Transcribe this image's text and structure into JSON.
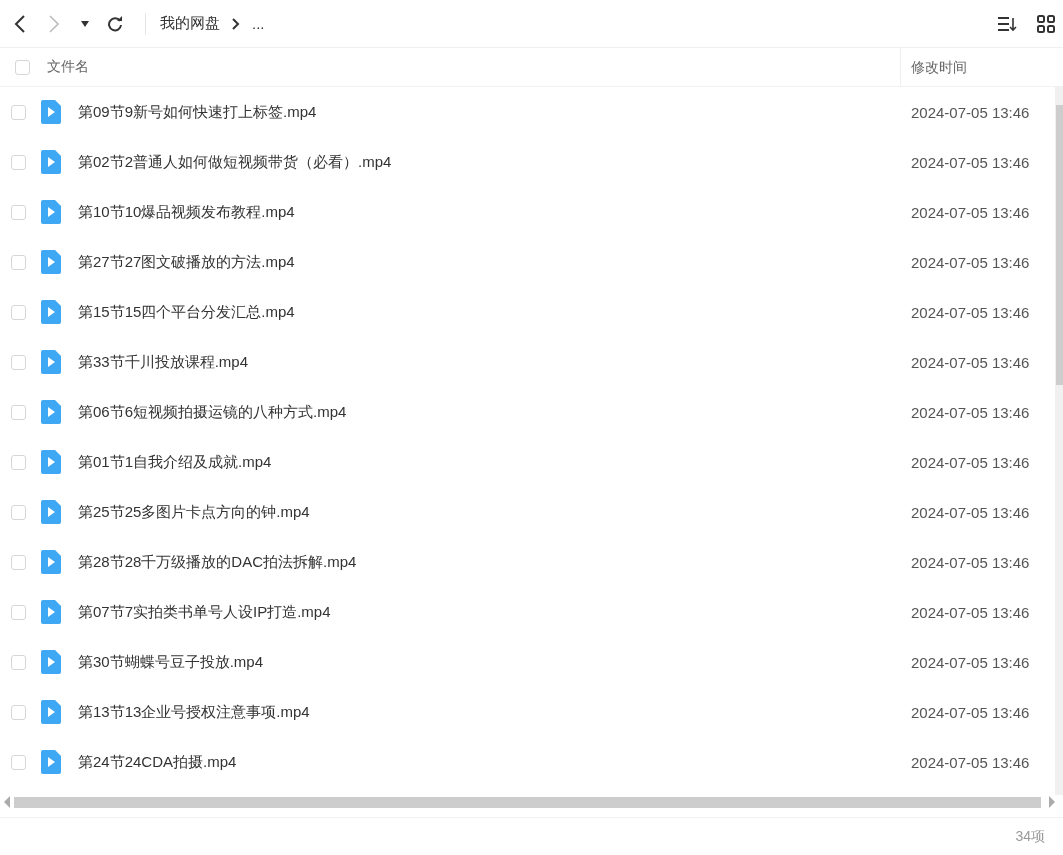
{
  "toolbar": {
    "breadcrumb": [
      "我的网盘",
      "..."
    ]
  },
  "table": {
    "columns": [
      "文件名",
      "修改时间"
    ],
    "all_checked": false,
    "rows": [
      {
        "name": "第09节9新号如何快速打上标签.mp4",
        "modified": "2024-07-05 13:46",
        "checked": false
      },
      {
        "name": "第02节2普通人如何做短视频带货（必看）.mp4",
        "modified": "2024-07-05 13:46",
        "checked": false
      },
      {
        "name": "第10节10爆品视频发布教程.mp4",
        "modified": "2024-07-05 13:46",
        "checked": false
      },
      {
        "name": "第27节27图文破播放的方法.mp4",
        "modified": "2024-07-05 13:46",
        "checked": false
      },
      {
        "name": "第15节15四个平台分发汇总.mp4",
        "modified": "2024-07-05 13:46",
        "checked": false
      },
      {
        "name": "第33节千川投放课程.mp4",
        "modified": "2024-07-05 13:46",
        "checked": false
      },
      {
        "name": "第06节6短视频拍摄运镜的八种方式.mp4",
        "modified": "2024-07-05 13:46",
        "checked": false
      },
      {
        "name": "第01节1自我介绍及成就.mp4",
        "modified": "2024-07-05 13:46",
        "checked": false
      },
      {
        "name": "第25节25多图片卡点方向的钟.mp4",
        "modified": "2024-07-05 13:46",
        "checked": false
      },
      {
        "name": "第28节28千万级播放的DAC拍法拆解.mp4",
        "modified": "2024-07-05 13:46",
        "checked": false
      },
      {
        "name": "第07节7实拍类书单号人设IP打造.mp4",
        "modified": "2024-07-05 13:46",
        "checked": false
      },
      {
        "name": "第30节蝴蝶号豆子投放.mp4",
        "modified": "2024-07-05 13:46",
        "checked": false
      },
      {
        "name": "第13节13企业号授权注意事项.mp4",
        "modified": "2024-07-05 13:46",
        "checked": false
      },
      {
        "name": "第24节24CDA拍摄.mp4",
        "modified": "2024-07-05 13:46",
        "checked": false
      }
    ]
  },
  "status_bar": {
    "count": "34项"
  }
}
